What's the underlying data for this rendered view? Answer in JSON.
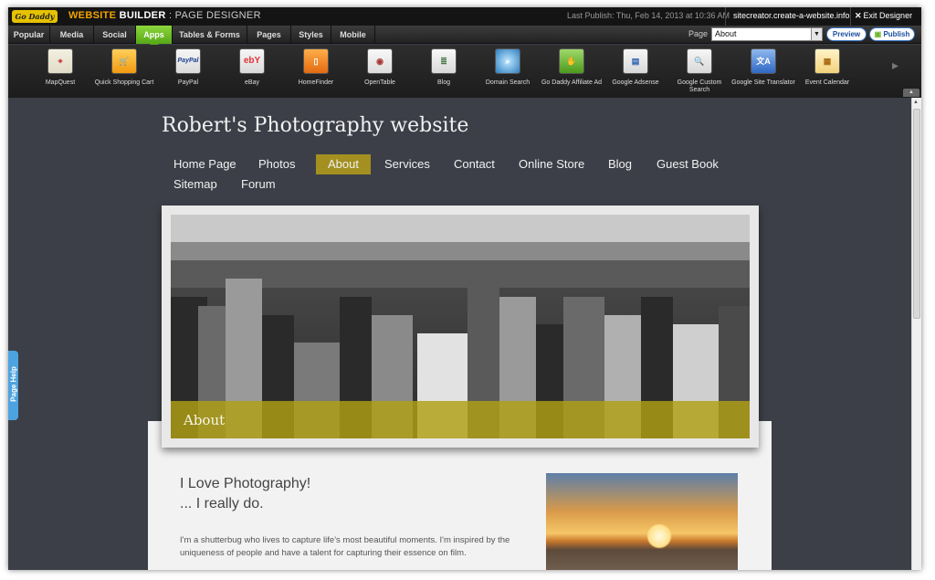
{
  "topbar": {
    "logo_text": "Go Daddy",
    "brand_primary": "WEBSITE",
    "brand_secondary": "BUILDER",
    "brand_section": ": PAGE DESIGNER",
    "last_publish": "Last Publish: Thu, Feb 14, 2013 at 10:36 AM",
    "site_url": "sitecreator.create-a-website.info",
    "exit_label": "Exit Designer"
  },
  "tabs": [
    {
      "label": "Popular"
    },
    {
      "label": "Media"
    },
    {
      "label": "Social"
    },
    {
      "label": "Apps",
      "active": true
    },
    {
      "label": "Tables & Forms"
    },
    {
      "label": "Pages"
    },
    {
      "label": "Styles"
    },
    {
      "label": "Mobile"
    }
  ],
  "page_select": {
    "label": "Page",
    "value": "About",
    "preview_label": "Preview",
    "publish_label": "Publish"
  },
  "apps": [
    {
      "label": "MapQuest",
      "icon": "map-icon"
    },
    {
      "label": "Quick Shopping Cart",
      "icon": "cart-icon"
    },
    {
      "label": "PayPal",
      "icon": "paypal-icon"
    },
    {
      "label": "eBay",
      "icon": "ebay-icon"
    },
    {
      "label": "HomeFinder",
      "icon": "door-icon"
    },
    {
      "label": "OpenTable",
      "icon": "plate-icon"
    },
    {
      "label": "Blog",
      "icon": "blog-icon"
    },
    {
      "label": "Domain Search",
      "icon": "globe-search-icon"
    },
    {
      "label": "Go Daddy Affiliate Ad",
      "icon": "handshake-icon"
    },
    {
      "label": "Google Adsense",
      "icon": "adsense-icon"
    },
    {
      "label": "Google Custom Search",
      "icon": "magnifier-icon"
    },
    {
      "label": "Google Site Translator",
      "icon": "translate-icon"
    },
    {
      "label": "Event Calendar",
      "icon": "calendar-icon"
    }
  ],
  "page_help_label": "Page Help",
  "site": {
    "title": "Robert's Photography website",
    "nav": [
      {
        "label": "Home Page"
      },
      {
        "label": "Photos"
      },
      {
        "label": "About",
        "active": true
      },
      {
        "label": "Services"
      },
      {
        "label": "Contact"
      },
      {
        "label": "Online Store"
      },
      {
        "label": "Blog"
      },
      {
        "label": "Guest Book"
      },
      {
        "label": "Sitemap"
      },
      {
        "label": "Forum"
      }
    ],
    "banner_caption": "About",
    "heading_line1": "I Love Photography!",
    "heading_line2": "... I really do.",
    "paragraph": "I'm a shutterbug who lives to capture life's most beautiful moments. I'm inspired by the uniqueness of people and have a talent for capturing their essence on film."
  },
  "colors": {
    "active_tab": "#56a818",
    "accent_gold": "#a39020",
    "canvas_bg": "#3c3f47"
  }
}
